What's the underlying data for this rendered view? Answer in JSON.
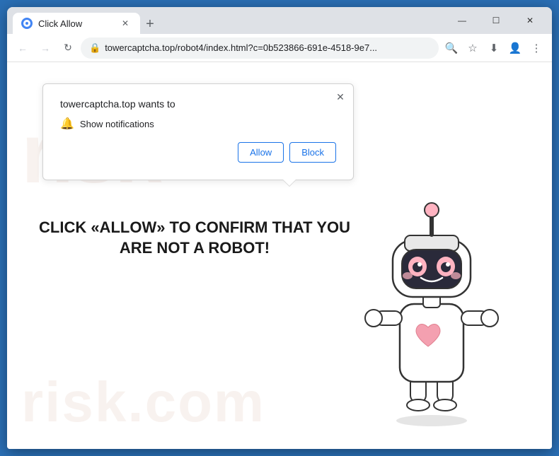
{
  "browser": {
    "title": "Click Allow",
    "tab_label": "Click Allow",
    "url": "towercaptcha.top/robot4/index.html?c=0b523866-691e-4518-9e7...",
    "new_tab_label": "+",
    "window_controls": {
      "minimize": "—",
      "maximize": "☐",
      "close": "✕"
    },
    "nav": {
      "back": "←",
      "forward": "→",
      "reload": "↻",
      "lock": "🔒"
    },
    "toolbar": {
      "search_icon": "🔍",
      "bookmark_icon": "☆",
      "profile_icon": "👤",
      "menu_icon": "⋮",
      "download_icon": "⬇"
    }
  },
  "notification_popup": {
    "title": "towercaptcha.top wants to",
    "notification_text": "Show notifications",
    "allow_label": "Allow",
    "block_label": "Block",
    "close_icon": "✕"
  },
  "page": {
    "cta_text": "CLICK «ALLOW» TO CONFIRM THAT YOU ARE NOT A ROBOT!",
    "watermark_top": "risk",
    "watermark_bottom": "risk.com"
  }
}
